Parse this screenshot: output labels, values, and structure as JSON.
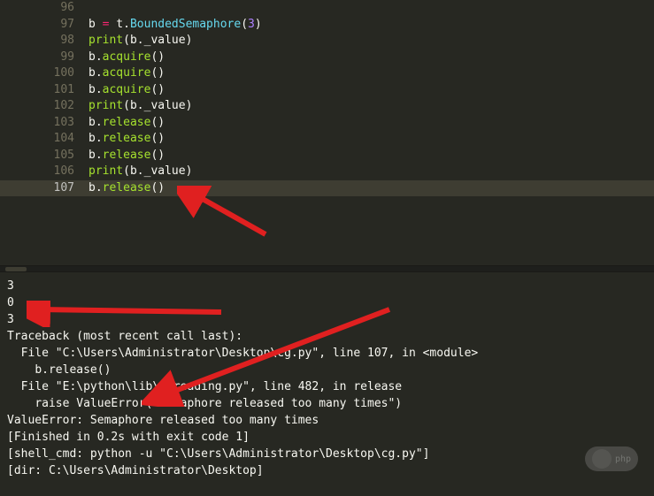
{
  "editor": {
    "lines": [
      {
        "num": "96",
        "active": false,
        "tokens": []
      },
      {
        "num": "97",
        "active": false,
        "tokens": [
          {
            "t": "var",
            "v": "b "
          },
          {
            "t": "op",
            "v": "="
          },
          {
            "t": "var",
            "v": " t"
          },
          {
            "t": "dot",
            "v": "."
          },
          {
            "t": "func",
            "v": "BoundedSemaphore"
          },
          {
            "t": "paren",
            "v": "("
          },
          {
            "t": "num",
            "v": "3"
          },
          {
            "t": "paren",
            "v": ")"
          }
        ]
      },
      {
        "num": "98",
        "active": false,
        "tokens": [
          {
            "t": "call",
            "v": "print"
          },
          {
            "t": "paren",
            "v": "("
          },
          {
            "t": "var",
            "v": "b"
          },
          {
            "t": "dot",
            "v": "."
          },
          {
            "t": "var",
            "v": "_value"
          },
          {
            "t": "paren",
            "v": ")"
          }
        ]
      },
      {
        "num": "99",
        "active": false,
        "tokens": [
          {
            "t": "var",
            "v": "b"
          },
          {
            "t": "dot",
            "v": "."
          },
          {
            "t": "call",
            "v": "acquire"
          },
          {
            "t": "paren",
            "v": "()"
          }
        ]
      },
      {
        "num": "100",
        "active": false,
        "tokens": [
          {
            "t": "var",
            "v": "b"
          },
          {
            "t": "dot",
            "v": "."
          },
          {
            "t": "call",
            "v": "acquire"
          },
          {
            "t": "paren",
            "v": "()"
          }
        ]
      },
      {
        "num": "101",
        "active": false,
        "tokens": [
          {
            "t": "var",
            "v": "b"
          },
          {
            "t": "dot",
            "v": "."
          },
          {
            "t": "call",
            "v": "acquire"
          },
          {
            "t": "paren",
            "v": "()"
          }
        ]
      },
      {
        "num": "102",
        "active": false,
        "tokens": [
          {
            "t": "call",
            "v": "print"
          },
          {
            "t": "paren",
            "v": "("
          },
          {
            "t": "var",
            "v": "b"
          },
          {
            "t": "dot",
            "v": "."
          },
          {
            "t": "var",
            "v": "_value"
          },
          {
            "t": "paren",
            "v": ")"
          }
        ]
      },
      {
        "num": "103",
        "active": false,
        "tokens": [
          {
            "t": "var",
            "v": "b"
          },
          {
            "t": "dot",
            "v": "."
          },
          {
            "t": "call",
            "v": "release"
          },
          {
            "t": "paren",
            "v": "()"
          }
        ]
      },
      {
        "num": "104",
        "active": false,
        "tokens": [
          {
            "t": "var",
            "v": "b"
          },
          {
            "t": "dot",
            "v": "."
          },
          {
            "t": "call",
            "v": "release"
          },
          {
            "t": "paren",
            "v": "()"
          }
        ]
      },
      {
        "num": "105",
        "active": false,
        "tokens": [
          {
            "t": "var",
            "v": "b"
          },
          {
            "t": "dot",
            "v": "."
          },
          {
            "t": "call",
            "v": "release"
          },
          {
            "t": "paren",
            "v": "()"
          }
        ]
      },
      {
        "num": "106",
        "active": false,
        "tokens": [
          {
            "t": "call",
            "v": "print"
          },
          {
            "t": "paren",
            "v": "("
          },
          {
            "t": "var",
            "v": "b"
          },
          {
            "t": "dot",
            "v": "."
          },
          {
            "t": "var",
            "v": "_value"
          },
          {
            "t": "paren",
            "v": ")"
          }
        ]
      },
      {
        "num": "107",
        "active": true,
        "tokens": [
          {
            "t": "var",
            "v": "b"
          },
          {
            "t": "dot",
            "v": "."
          },
          {
            "t": "call",
            "v": "release"
          },
          {
            "t": "paren",
            "v": "()"
          }
        ]
      }
    ]
  },
  "output": {
    "lines": [
      "3",
      "0",
      "3",
      "Traceback (most recent call last):",
      "  File \"C:\\Users\\Administrator\\Desktop\\cg.py\", line 107, in <module>",
      "    b.release()",
      "  File \"E:\\python\\lib\\threading.py\", line 482, in release",
      "    raise ValueError(\"Semaphore released too many times\")",
      "ValueError: Semaphore released too many times",
      "[Finished in 0.2s with exit code 1]",
      "[shell_cmd: python -u \"C:\\Users\\Administrator\\Desktop\\cg.py\"]",
      "[dir: C:\\Users\\Administrator\\Desktop]"
    ]
  },
  "watermark": {
    "text": "php"
  }
}
